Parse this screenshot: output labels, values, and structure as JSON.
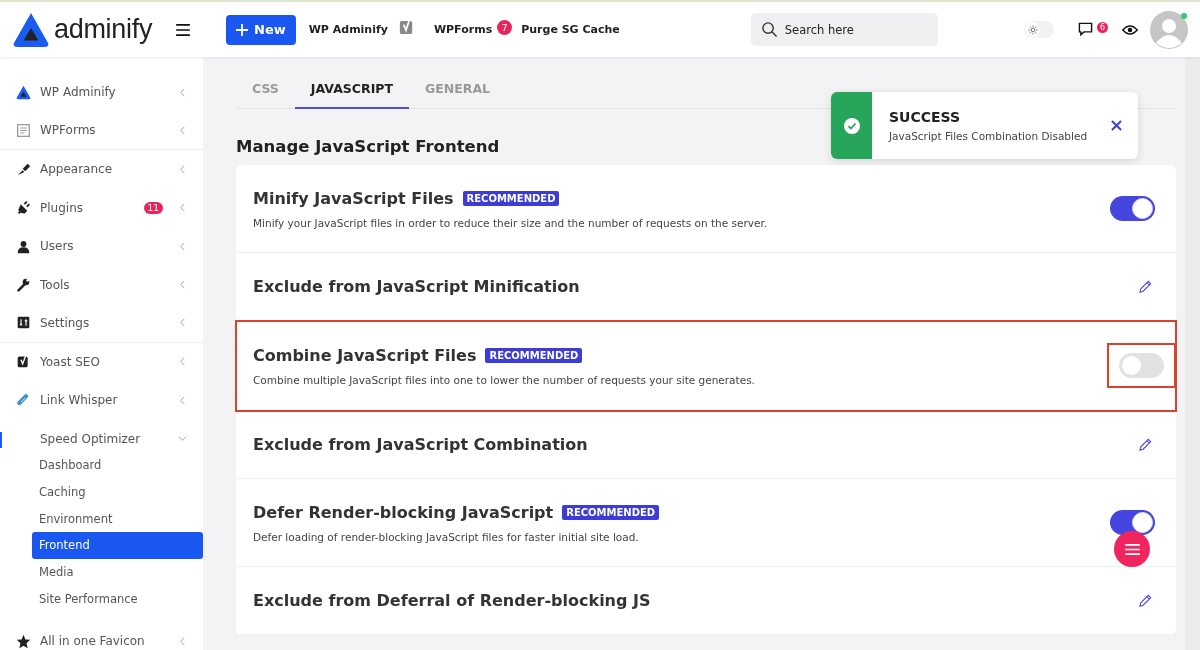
{
  "header": {
    "logo": "adminify",
    "new_button": "New",
    "links": [
      {
        "label": "WP Adminify",
        "kind": "text"
      },
      {
        "kind": "yoast"
      },
      {
        "label": "WPForms",
        "kind": "text",
        "badge": "7"
      },
      {
        "label": "Purge SG Cache",
        "kind": "text"
      }
    ],
    "search": {
      "placeholder": "Search here"
    },
    "dark_mode": {
      "on": false
    },
    "comments_badge": "6",
    "user_online": true
  },
  "sidebar": {
    "items": [
      {
        "label": "WP Adminify",
        "divider_after": false
      },
      {
        "label": "WPForms",
        "divider_after": true
      },
      {
        "label": "Appearance",
        "divider_after": false
      },
      {
        "label": "Plugins",
        "badge": "11",
        "divider_after": false
      },
      {
        "label": "Users",
        "divider_after": false
      },
      {
        "label": "Tools",
        "divider_after": false
      },
      {
        "label": "Settings",
        "divider_after": true
      },
      {
        "label": "Yoast SEO",
        "divider_after": false
      },
      {
        "label": "Link Whisper",
        "divider_after": false
      },
      {
        "label": "Speed Optimizer",
        "expanded": true,
        "divider_after": false,
        "children": [
          {
            "label": "Dashboard",
            "selected": false
          },
          {
            "label": "Caching",
            "selected": false
          },
          {
            "label": "Environment",
            "selected": false
          },
          {
            "label": "Frontend",
            "selected": true
          },
          {
            "label": "Media",
            "selected": false
          },
          {
            "label": "Site Performance",
            "selected": false
          }
        ]
      },
      {
        "label": "All in one Favicon",
        "divider_after": false
      }
    ]
  },
  "tabs": [
    {
      "label": "CSS",
      "selected": false
    },
    {
      "label": "JAVASCRIPT",
      "selected": true
    },
    {
      "label": "GENERAL",
      "selected": false
    }
  ],
  "heading": "Manage JavaScript Frontend",
  "settings": [
    {
      "kind": "toggle",
      "title": "Minify JavaScript Files",
      "badge": "RECOMMENDED",
      "description": "Minify your JavaScript files in order to reduce their size and the number of requests on the server.",
      "on": true,
      "highlighted": false
    },
    {
      "kind": "edit",
      "title": "Exclude from JavaScript Minification",
      "highlighted": false
    },
    {
      "kind": "toggle",
      "title": "Combine JavaScript Files",
      "badge": "RECOMMENDED",
      "description": "Combine multiple JavaScript files into one to lower the number of requests your site generates.",
      "on": false,
      "highlighted": true
    },
    {
      "kind": "edit",
      "title": "Exclude from JavaScript Combination",
      "highlighted": false
    },
    {
      "kind": "toggle",
      "title": "Defer Render-blocking JavaScript",
      "badge": "RECOMMENDED",
      "description": "Defer loading of render-blocking JavaScript files for faster initial site load.",
      "on": true,
      "highlighted": false
    },
    {
      "kind": "edit",
      "title": "Exclude from Deferral of Render-blocking JS",
      "highlighted": false
    }
  ],
  "toast": {
    "title": "SUCCESS",
    "message": "JavaScript Files Combination Disabled"
  }
}
